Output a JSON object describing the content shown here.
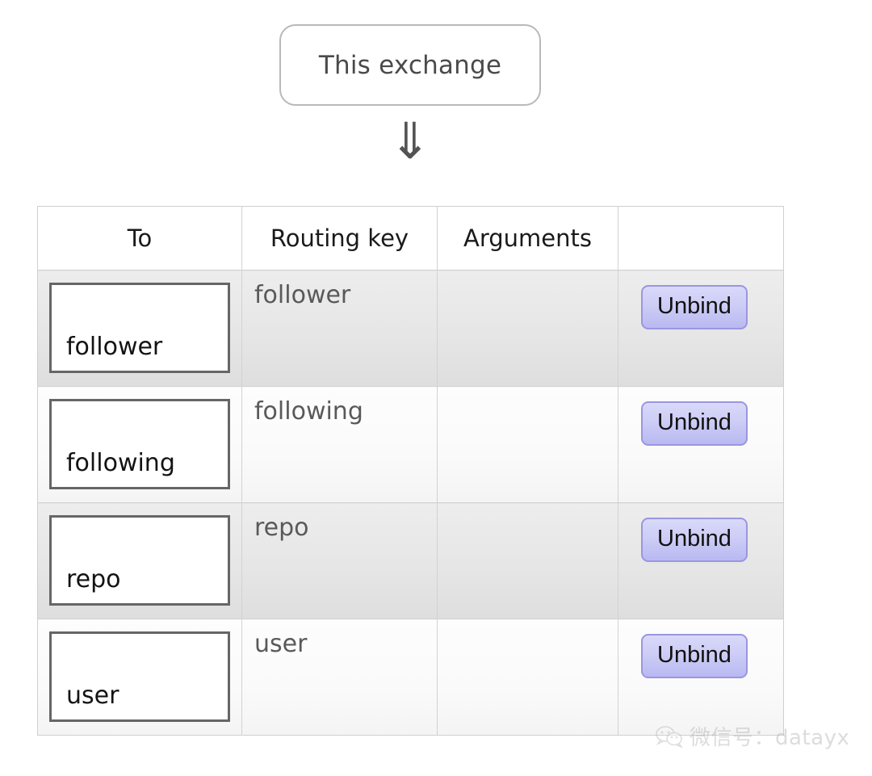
{
  "diagram": {
    "source_node": {
      "label": "This exchange",
      "icon": "rounded-rect-node"
    },
    "arrow": {
      "glyph": "⇓",
      "icon": "double-down-arrow-icon"
    }
  },
  "table": {
    "columns": [
      {
        "key": "to",
        "label": "To"
      },
      {
        "key": "routing_key",
        "label": "Routing key"
      },
      {
        "key": "arguments",
        "label": "Arguments"
      },
      {
        "key": "actions",
        "label": ""
      }
    ],
    "rows": [
      {
        "to": "follower",
        "routing_key": "follower",
        "arguments": "",
        "action_label": "Unbind"
      },
      {
        "to": "following",
        "routing_key": "following",
        "arguments": "",
        "action_label": "Unbind"
      },
      {
        "to": "repo",
        "routing_key": "repo",
        "arguments": "",
        "action_label": "Unbind"
      },
      {
        "to": "user",
        "routing_key": "user",
        "arguments": "",
        "action_label": "Unbind"
      }
    ]
  },
  "watermark": {
    "text": "微信号：datayx",
    "icon": "wechat-icon"
  },
  "colors": {
    "node_border": "#b9b9b9",
    "node_text": "#4a4a4a",
    "arrow": "#535353",
    "table_border": "#d2d2d2",
    "header_text": "#1a1a1a",
    "queue_box_border": "#666666",
    "routing_key_text": "#595959",
    "button_fill_top": "#d9d9fa",
    "button_fill_bottom": "#b9b9f2",
    "button_border": "#9a96e0",
    "button_text": "#111111",
    "row_striped": "#e6e6e6",
    "row_plain": "#fafafa",
    "watermark": "#aeaeae"
  }
}
